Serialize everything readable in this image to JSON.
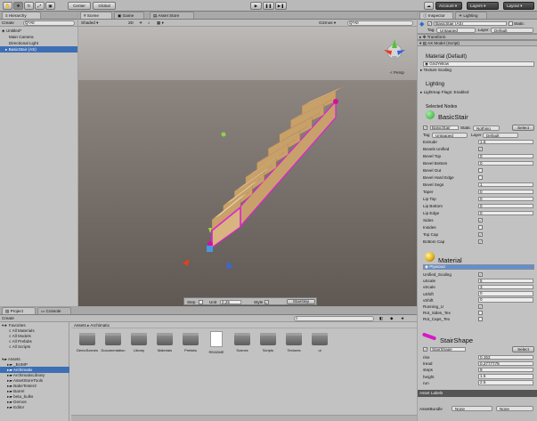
{
  "toolbar": {
    "pivot_label": "Center",
    "space_label": "Global",
    "account_label": "Account",
    "layers_label": "Layers",
    "layout_label": "Layout",
    "play_icon": "▶",
    "pause_icon": "❚❚",
    "step_icon": "▶❚"
  },
  "hierarchy": {
    "tab": "Hierarchy",
    "create_label": "Create",
    "search_placeholder": "Q*All",
    "scene_name": "Untitled*",
    "items": [
      {
        "label": "Main Camera",
        "selected": false
      },
      {
        "label": "Directional Light",
        "selected": false
      },
      {
        "label": "BasicStair (AS)",
        "selected": true
      }
    ]
  },
  "scene_view": {
    "tabs": [
      "Scene",
      "Game",
      "Asset Store"
    ],
    "shading_mode": "Shaded",
    "mode_2d": "2D",
    "gizmos_label": "Gizmos",
    "search_all": "Q*All",
    "persp_label": "< Persp",
    "step_label": "Step",
    "step_value": "0.25",
    "unit_label": "Unit",
    "unit_value": "0.25",
    "style_label": "Style",
    "style_checked": true,
    "stairstep_button": "Stairstep"
  },
  "project": {
    "tabs": [
      "Project",
      "Console"
    ],
    "create_label": "Create",
    "favorites_label": "Favorites",
    "favorites": [
      "All Materials",
      "All Models",
      "All Prefabs",
      "All Scripts"
    ],
    "assets_label": "Assets",
    "folders": [
      "_BUMP",
      "Archimatix",
      "ArchimatixLibrary",
      "AssetStoreTools",
      "BabeTester2",
      "Barrel",
      "beta_bulks",
      "Demos",
      "Editor"
    ],
    "breadcrumb": [
      "Assets",
      "Archimatix"
    ],
    "grid": [
      {
        "name": "DemoScenes",
        "kind": "folder"
      },
      {
        "name": "Documentation",
        "kind": "folder"
      },
      {
        "name": "Library",
        "kind": "folder"
      },
      {
        "name": "Materials",
        "kind": "folder"
      },
      {
        "name": "Prefabs",
        "kind": "folder"
      },
      {
        "name": "README",
        "kind": "document"
      },
      {
        "name": "Scenes",
        "kind": "folder"
      },
      {
        "name": "Scripts",
        "kind": "folder"
      },
      {
        "name": "Textures",
        "kind": "folder"
      },
      {
        "name": "ui",
        "kind": "folder"
      }
    ]
  },
  "inspector": {
    "tabs": [
      "Inspector",
      "Lighting"
    ],
    "object_name": "BasicStair (AS)",
    "static_label": "Static",
    "tag_label": "Tag",
    "tag_value": "Untagged",
    "layer_label": "Layer",
    "layer_value": "Default",
    "transform_label": "Transform",
    "script_component": "AX Model (Script)",
    "material_default_label": "Material (Default)",
    "material_default_value": "GridYellow",
    "texture_scaling_label": "Texture Scaling",
    "lighting_label": "Lighting",
    "lightmap_flags": "Lightmap Flags: Enabled",
    "selected_nodes_label": "Selected Nodes",
    "node_name": "BasicStair",
    "node_name_field": "BasicStair",
    "node_static_label": "Static",
    "node_static_value": "Nothing",
    "select_button": "Select",
    "node_tag_value": "Untagged",
    "node_layer_value": "Default",
    "params": [
      {
        "label": "Extrude",
        "type": "num",
        "value": "1.5"
      },
      {
        "label": "Bevels Unified",
        "type": "check",
        "value": "✓"
      },
      {
        "label": "Bevel Top",
        "type": "num",
        "value": "0"
      },
      {
        "label": "Bevel Bottom",
        "type": "num",
        "value": "0"
      },
      {
        "label": "Bevel Out",
        "type": "check",
        "value": ""
      },
      {
        "label": "Bevel Hard Edge",
        "type": "check",
        "value": ""
      },
      {
        "label": "Bevel Segs",
        "type": "num",
        "value": "1"
      },
      {
        "label": "Taper",
        "type": "num",
        "value": "0"
      },
      {
        "label": "Lip Top",
        "type": "num",
        "value": "0"
      },
      {
        "label": "Lip Bottom",
        "type": "num",
        "value": "0"
      },
      {
        "label": "Lip Edge",
        "type": "num",
        "value": "0"
      },
      {
        "label": "Sides",
        "type": "check",
        "value": "✓"
      },
      {
        "label": "Insides",
        "type": "check",
        "value": ""
      },
      {
        "label": "Top Cap",
        "type": "check",
        "value": "✓"
      },
      {
        "label": "Bottom Cap",
        "type": "check",
        "value": "✓"
      }
    ],
    "material_section_label": "Material",
    "material_value": "Plywood",
    "material_params": [
      {
        "label": "Unified_Scaling",
        "type": "check",
        "value": "✓"
      },
      {
        "label": "uScale",
        "type": "num",
        "value": "5"
      },
      {
        "label": "vScale",
        "type": "num",
        "value": "3"
      },
      {
        "label": "uShift",
        "type": "num",
        "value": "0"
      },
      {
        "label": "vShift",
        "type": "num",
        "value": "0"
      },
      {
        "label": "Running_U",
        "type": "check",
        "value": "✓"
      },
      {
        "label": "Rot_Sides_Tex",
        "type": "check",
        "value": ""
      },
      {
        "label": "Rot_Caps_Tex",
        "type": "check",
        "value": ""
      }
    ],
    "shape_label": "StairShape",
    "shape_field": "StairShape",
    "shape_select": "Select",
    "shape_params": [
      {
        "label": "rise",
        "value": "0.152"
      },
      {
        "label": "tread",
        "value": "0.2777778"
      },
      {
        "label": "steps",
        "value": "9"
      },
      {
        "label": "height",
        "value": "1.5"
      },
      {
        "label": "run",
        "value": "2.5"
      }
    ],
    "asset_labels": "Asset Labels",
    "asset_bundle_label": "AssetBundle",
    "asset_bundle_value": "None",
    "asset_bundle_variant": "None"
  },
  "colors": {
    "selection": "#3d6fb4",
    "scene_sky": "#b4b1ae",
    "scene_ground": "#6e6661",
    "stair_outline": "#e01ed6",
    "wood_top": "#ead1a2",
    "wood_side": "#c8a06a"
  }
}
